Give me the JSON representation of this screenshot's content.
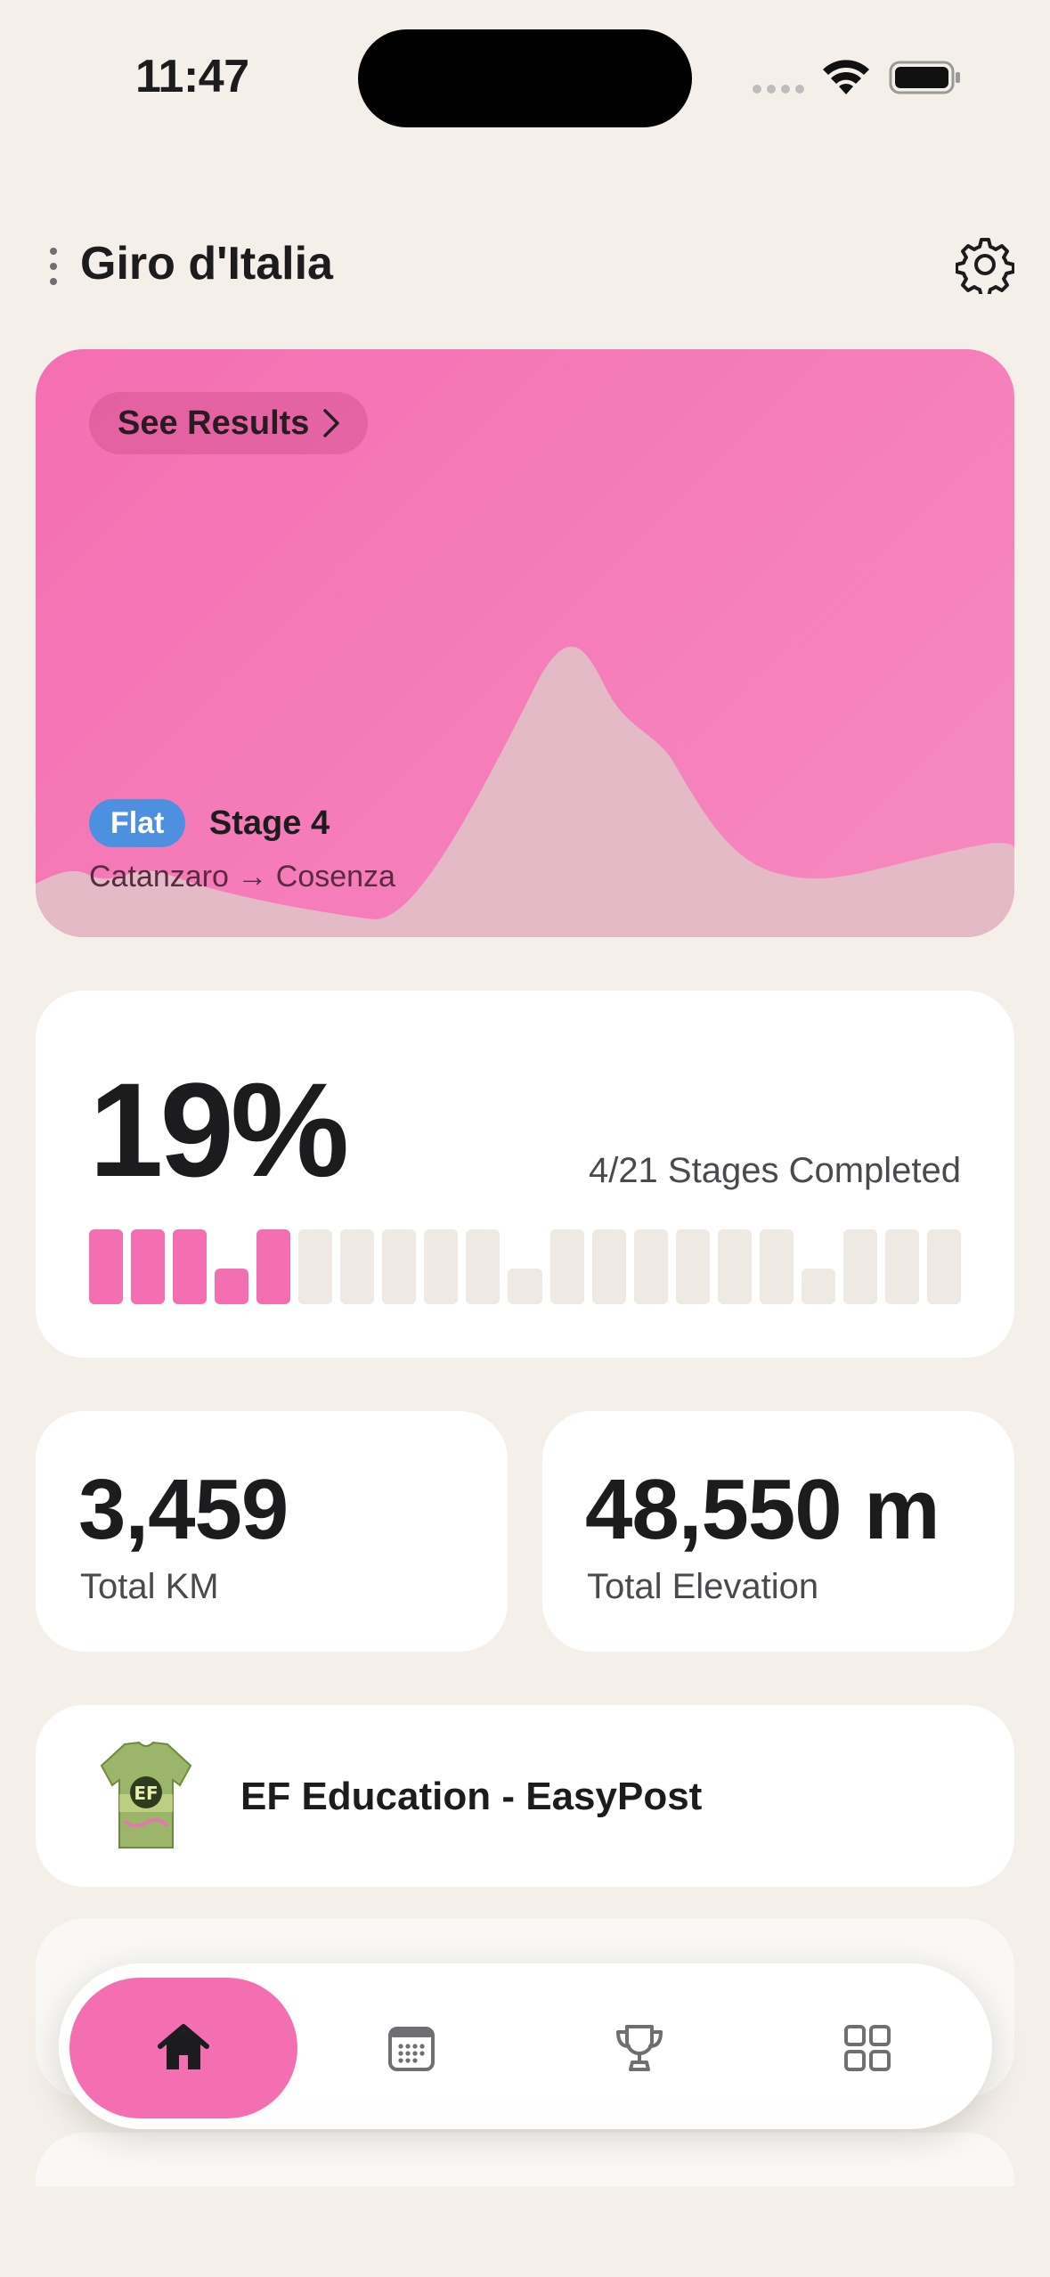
{
  "status_bar": {
    "time": "11:47"
  },
  "header": {
    "title": "Giro d'Italia"
  },
  "stage_card": {
    "see_results_label": "See Results",
    "badge": "Flat",
    "stage": "Stage 4",
    "route": "Catanzaro → Cosenza",
    "colors": {
      "card": "#F46FB2",
      "badge": "#4E90E0"
    }
  },
  "progress": {
    "percent_label": "19%",
    "stages_label": "4/21 Stages Completed",
    "completed": 4,
    "total": 21,
    "colors": {
      "done": "#F46FB2",
      "todo": "#EEE9E2"
    }
  },
  "stats": {
    "km_value": "3,459",
    "km_label": "Total KM",
    "elev_value": "48,550 m",
    "elev_label": "Total Elevation"
  },
  "teams": [
    {
      "name": "EF Education - EasyPost"
    }
  ],
  "tabbar": {
    "tabs": [
      {
        "icon": "home-icon",
        "active": true
      },
      {
        "icon": "calendar-icon",
        "active": false
      },
      {
        "icon": "trophy-icon",
        "active": false
      },
      {
        "icon": "grid-icon",
        "active": false
      }
    ]
  }
}
